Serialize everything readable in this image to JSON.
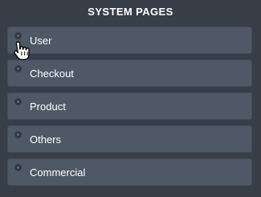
{
  "header": {
    "title": "SYSTEM PAGES"
  },
  "items": [
    {
      "label": "User",
      "icon": "bullet-icon"
    },
    {
      "label": "Checkout",
      "icon": "bullet-icon"
    },
    {
      "label": "Product",
      "icon": "bullet-icon"
    },
    {
      "label": "Others",
      "icon": "bullet-icon"
    },
    {
      "label": "Commercial",
      "icon": "bullet-icon"
    }
  ],
  "cursor": {
    "icon": "hand-pointer-icon",
    "hovered_item": "User"
  },
  "colors": {
    "background": "#383e48",
    "item_background": "#4f5866",
    "text": "#ffffff"
  }
}
